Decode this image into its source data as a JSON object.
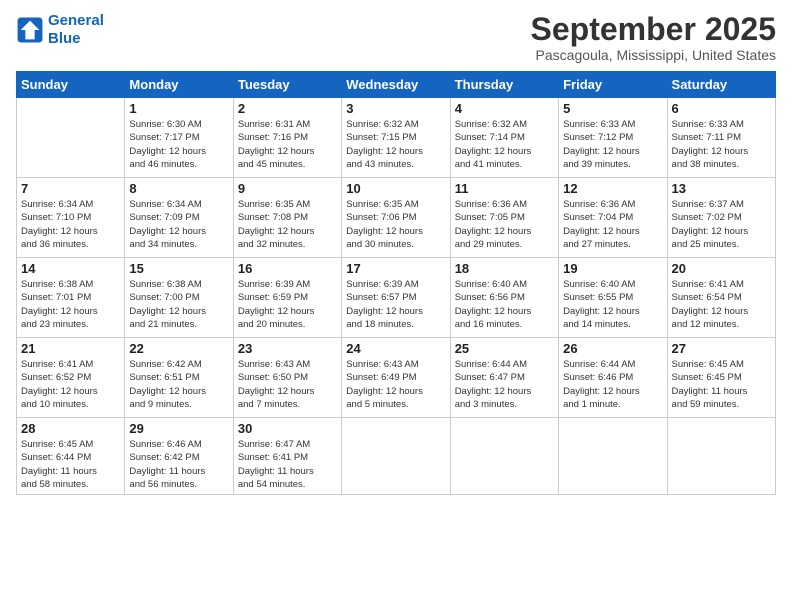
{
  "logo": {
    "line1": "General",
    "line2": "Blue"
  },
  "title": "September 2025",
  "location": "Pascagoula, Mississippi, United States",
  "weekdays": [
    "Sunday",
    "Monday",
    "Tuesday",
    "Wednesday",
    "Thursday",
    "Friday",
    "Saturday"
  ],
  "weeks": [
    [
      {
        "day": "",
        "info": ""
      },
      {
        "day": "1",
        "info": "Sunrise: 6:30 AM\nSunset: 7:17 PM\nDaylight: 12 hours\nand 46 minutes."
      },
      {
        "day": "2",
        "info": "Sunrise: 6:31 AM\nSunset: 7:16 PM\nDaylight: 12 hours\nand 45 minutes."
      },
      {
        "day": "3",
        "info": "Sunrise: 6:32 AM\nSunset: 7:15 PM\nDaylight: 12 hours\nand 43 minutes."
      },
      {
        "day": "4",
        "info": "Sunrise: 6:32 AM\nSunset: 7:14 PM\nDaylight: 12 hours\nand 41 minutes."
      },
      {
        "day": "5",
        "info": "Sunrise: 6:33 AM\nSunset: 7:12 PM\nDaylight: 12 hours\nand 39 minutes."
      },
      {
        "day": "6",
        "info": "Sunrise: 6:33 AM\nSunset: 7:11 PM\nDaylight: 12 hours\nand 38 minutes."
      }
    ],
    [
      {
        "day": "7",
        "info": "Sunrise: 6:34 AM\nSunset: 7:10 PM\nDaylight: 12 hours\nand 36 minutes."
      },
      {
        "day": "8",
        "info": "Sunrise: 6:34 AM\nSunset: 7:09 PM\nDaylight: 12 hours\nand 34 minutes."
      },
      {
        "day": "9",
        "info": "Sunrise: 6:35 AM\nSunset: 7:08 PM\nDaylight: 12 hours\nand 32 minutes."
      },
      {
        "day": "10",
        "info": "Sunrise: 6:35 AM\nSunset: 7:06 PM\nDaylight: 12 hours\nand 30 minutes."
      },
      {
        "day": "11",
        "info": "Sunrise: 6:36 AM\nSunset: 7:05 PM\nDaylight: 12 hours\nand 29 minutes."
      },
      {
        "day": "12",
        "info": "Sunrise: 6:36 AM\nSunset: 7:04 PM\nDaylight: 12 hours\nand 27 minutes."
      },
      {
        "day": "13",
        "info": "Sunrise: 6:37 AM\nSunset: 7:02 PM\nDaylight: 12 hours\nand 25 minutes."
      }
    ],
    [
      {
        "day": "14",
        "info": "Sunrise: 6:38 AM\nSunset: 7:01 PM\nDaylight: 12 hours\nand 23 minutes."
      },
      {
        "day": "15",
        "info": "Sunrise: 6:38 AM\nSunset: 7:00 PM\nDaylight: 12 hours\nand 21 minutes."
      },
      {
        "day": "16",
        "info": "Sunrise: 6:39 AM\nSunset: 6:59 PM\nDaylight: 12 hours\nand 20 minutes."
      },
      {
        "day": "17",
        "info": "Sunrise: 6:39 AM\nSunset: 6:57 PM\nDaylight: 12 hours\nand 18 minutes."
      },
      {
        "day": "18",
        "info": "Sunrise: 6:40 AM\nSunset: 6:56 PM\nDaylight: 12 hours\nand 16 minutes."
      },
      {
        "day": "19",
        "info": "Sunrise: 6:40 AM\nSunset: 6:55 PM\nDaylight: 12 hours\nand 14 minutes."
      },
      {
        "day": "20",
        "info": "Sunrise: 6:41 AM\nSunset: 6:54 PM\nDaylight: 12 hours\nand 12 minutes."
      }
    ],
    [
      {
        "day": "21",
        "info": "Sunrise: 6:41 AM\nSunset: 6:52 PM\nDaylight: 12 hours\nand 10 minutes."
      },
      {
        "day": "22",
        "info": "Sunrise: 6:42 AM\nSunset: 6:51 PM\nDaylight: 12 hours\nand 9 minutes."
      },
      {
        "day": "23",
        "info": "Sunrise: 6:43 AM\nSunset: 6:50 PM\nDaylight: 12 hours\nand 7 minutes."
      },
      {
        "day": "24",
        "info": "Sunrise: 6:43 AM\nSunset: 6:49 PM\nDaylight: 12 hours\nand 5 minutes."
      },
      {
        "day": "25",
        "info": "Sunrise: 6:44 AM\nSunset: 6:47 PM\nDaylight: 12 hours\nand 3 minutes."
      },
      {
        "day": "26",
        "info": "Sunrise: 6:44 AM\nSunset: 6:46 PM\nDaylight: 12 hours\nand 1 minute."
      },
      {
        "day": "27",
        "info": "Sunrise: 6:45 AM\nSunset: 6:45 PM\nDaylight: 11 hours\nand 59 minutes."
      }
    ],
    [
      {
        "day": "28",
        "info": "Sunrise: 6:45 AM\nSunset: 6:44 PM\nDaylight: 11 hours\nand 58 minutes."
      },
      {
        "day": "29",
        "info": "Sunrise: 6:46 AM\nSunset: 6:42 PM\nDaylight: 11 hours\nand 56 minutes."
      },
      {
        "day": "30",
        "info": "Sunrise: 6:47 AM\nSunset: 6:41 PM\nDaylight: 11 hours\nand 54 minutes."
      },
      {
        "day": "",
        "info": ""
      },
      {
        "day": "",
        "info": ""
      },
      {
        "day": "",
        "info": ""
      },
      {
        "day": "",
        "info": ""
      }
    ]
  ]
}
